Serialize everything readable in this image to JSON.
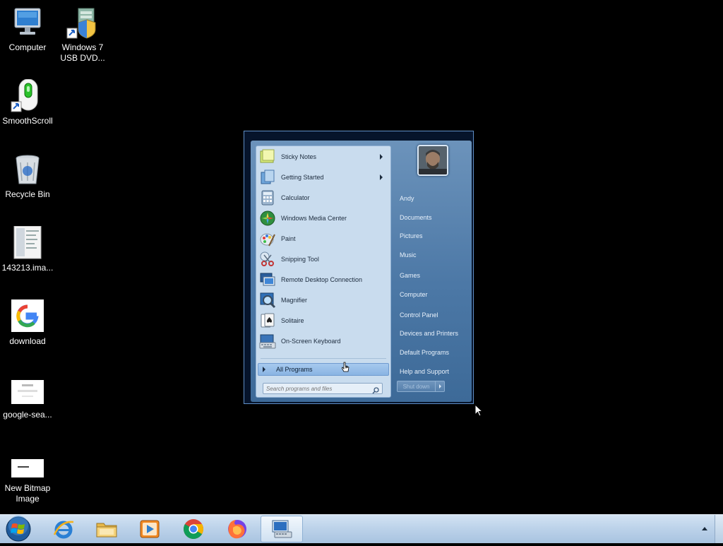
{
  "desktop": {
    "icons": [
      {
        "label": "Computer"
      },
      {
        "label": "Windows 7 USB DVD..."
      },
      {
        "label": "SmoothScroll"
      },
      {
        "label": "Recycle Bin"
      },
      {
        "label": "143213.ima..."
      },
      {
        "label": "download"
      },
      {
        "label": "google-sea..."
      },
      {
        "label": "New Bitmap Image"
      }
    ]
  },
  "start_menu": {
    "programs": [
      {
        "label": "Sticky Notes",
        "icon": "sticky-notes-icon",
        "has_submenu": true
      },
      {
        "label": "Getting Started",
        "icon": "getting-started-icon",
        "has_submenu": true
      },
      {
        "label": "Calculator",
        "icon": "calculator-icon",
        "has_submenu": false
      },
      {
        "label": "Windows Media Center",
        "icon": "media-center-icon",
        "has_submenu": false
      },
      {
        "label": "Paint",
        "icon": "paint-icon",
        "has_submenu": false
      },
      {
        "label": "Snipping Tool",
        "icon": "snipping-tool-icon",
        "has_submenu": false
      },
      {
        "label": "Remote Desktop Connection",
        "icon": "remote-desktop-icon",
        "has_submenu": false
      },
      {
        "label": "Magnifier",
        "icon": "magnifier-icon",
        "has_submenu": false
      },
      {
        "label": "Solitaire",
        "icon": "solitaire-icon",
        "has_submenu": false
      },
      {
        "label": "On-Screen Keyboard",
        "icon": "keyboard-icon",
        "has_submenu": false
      }
    ],
    "all_programs_label": "All Programs",
    "search_placeholder": "Search programs and files",
    "right_links": [
      {
        "label": "Andy"
      },
      {
        "label": "Documents"
      },
      {
        "label": "Pictures"
      },
      {
        "label": "Music"
      },
      {
        "label": "Games"
      },
      {
        "label": "Computer"
      },
      {
        "label": "Control Panel"
      },
      {
        "label": "Devices and Printers"
      },
      {
        "label": "Default Programs"
      },
      {
        "label": "Help and Support"
      }
    ],
    "shutdown_label": "Shut down"
  },
  "taskbar": {
    "pinned": [
      {
        "icon": "internet-explorer-icon"
      },
      {
        "icon": "file-explorer-icon"
      },
      {
        "icon": "media-player-icon"
      },
      {
        "icon": "chrome-icon"
      },
      {
        "icon": "firefox-icon"
      },
      {
        "icon": "remote-desktop-taskbar-icon",
        "active": true
      }
    ]
  },
  "colors": {
    "menu_frame": "#4c78a6",
    "left_panel": "#c9dcee",
    "taskbar": "#bdd3ea"
  }
}
